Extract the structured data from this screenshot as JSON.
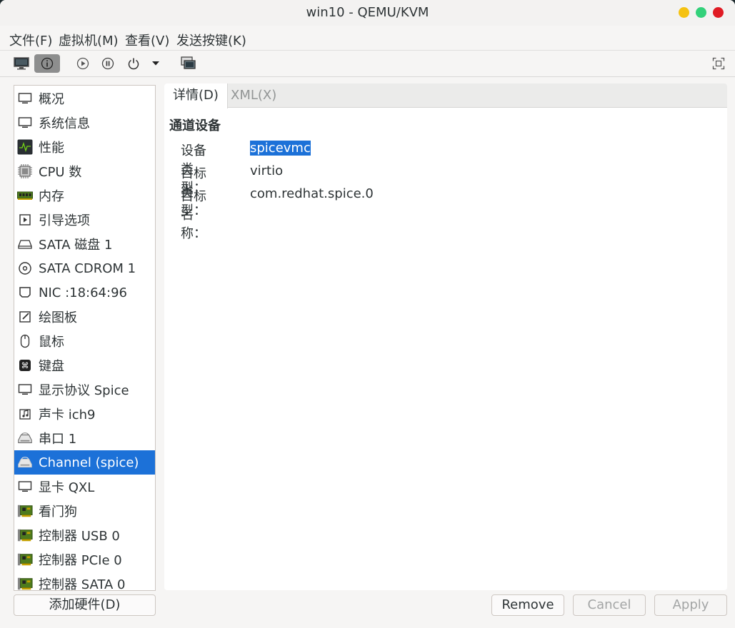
{
  "window": {
    "title": "win10 - QEMU/KVM"
  },
  "menu": [
    "文件(F)",
    "虚拟机(M)",
    "查看(V)",
    "发送按键(K)"
  ],
  "toolbar": {
    "icons": [
      "monitor-icon",
      "info-icon",
      "play-icon",
      "pause-icon",
      "power-icon",
      "dropdown-arrow-icon",
      "snapshots-icon",
      "fullscreen-icon"
    ],
    "active": "info-icon"
  },
  "sidebar": {
    "items": [
      {
        "label": "概况",
        "icon": "monitor-icon"
      },
      {
        "label": "系统信息",
        "icon": "monitor-icon"
      },
      {
        "label": "性能",
        "icon": "performance-icon"
      },
      {
        "label": "CPU 数",
        "icon": "cpu-icon"
      },
      {
        "label": "内存",
        "icon": "memory-icon"
      },
      {
        "label": "引导选项",
        "icon": "boot-icon"
      },
      {
        "label": "SATA 磁盘 1",
        "icon": "disk-icon"
      },
      {
        "label": "SATA CDROM 1",
        "icon": "cdrom-icon"
      },
      {
        "label": "NIC :18:64:96",
        "icon": "network-icon"
      },
      {
        "label": "绘图板",
        "icon": "tablet-icon"
      },
      {
        "label": "鼠标",
        "icon": "mouse-icon"
      },
      {
        "label": "键盘",
        "icon": "keyboard-icon"
      },
      {
        "label": "显示协议 Spice",
        "icon": "monitor-icon"
      },
      {
        "label": "声卡 ich9",
        "icon": "sound-icon"
      },
      {
        "label": "串口 1",
        "icon": "serial-icon"
      },
      {
        "label": "Channel (spice)",
        "icon": "serial-icon"
      },
      {
        "label": "显卡 QXL",
        "icon": "monitor-icon"
      },
      {
        "label": "看门狗",
        "icon": "pci-card-icon"
      },
      {
        "label": "控制器 USB 0",
        "icon": "pci-card-icon"
      },
      {
        "label": "控制器 PCIe 0",
        "icon": "pci-card-icon"
      },
      {
        "label": "控制器 SATA 0",
        "icon": "pci-card-icon"
      }
    ],
    "selected": "Channel (spice)",
    "add_button": "添加硬件(D)"
  },
  "details": {
    "tabs": [
      "详情(D)",
      "XML(X)"
    ],
    "section_title": "通道设备",
    "fields": [
      {
        "label": "设备类型：",
        "value": "spicevmc"
      },
      {
        "label": "目标类型：",
        "value": "virtio"
      },
      {
        "label": "目标名称：",
        "value": "com.redhat.spice.0"
      }
    ]
  },
  "buttons": {
    "remove": "Remove",
    "cancel": "Cancel",
    "apply": "Apply"
  },
  "colors": {
    "selection": "#1c71d8",
    "pci_green": "#4e7b1d"
  }
}
